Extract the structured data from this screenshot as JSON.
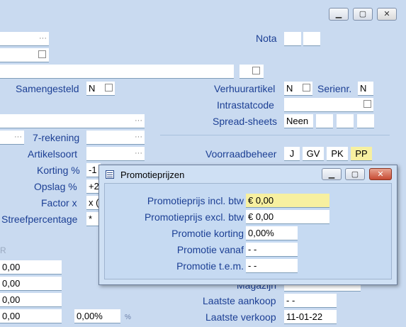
{
  "main": {
    "labels": {
      "nota": "Nota",
      "samengesteld": "Samengesteld",
      "verhuurartikel": "Verhuurartikel",
      "serienr": "Serienr.",
      "intrastatcode": "Intrastatcode",
      "spreadsheets": "Spread-sheets",
      "zeven_rekening": "7-rekening",
      "artikelsoort": "Artikelsoort",
      "korting_pct": "Korting %",
      "opslag_pct": "Opslag %",
      "factor_x": "Factor  x",
      "streefpercentage": "Streefpercentage",
      "voorraadbeheer": "Voorraadbeheer",
      "magazijn": "Magazijn",
      "laatste_aankoop": "Laatste aankoop",
      "laatste_verkoop": "Laatste verkoop",
      "r_header": "R",
      "percent_sign": "%"
    },
    "values": {
      "samengesteld": "N",
      "verhuurartikel": "N",
      "serienr": "N",
      "spreadsheets": "Neen",
      "korting": "-1",
      "opslag": "+2",
      "factor": "x (",
      "streef": "*",
      "price1": "0,00",
      "price2": "0,00",
      "price3": "0,00",
      "price4": "0,00",
      "percent_value": "0,00%",
      "laatste_aankoop": "-  -",
      "laatste_verkoop": "11-01-22",
      "dots": "···"
    },
    "voorraad_codes": [
      "J",
      "GV",
      "PK",
      "PP"
    ],
    "highlight_color": "#f7f0a0"
  },
  "dialog": {
    "title": "Promotieprijzen",
    "rows": [
      {
        "label": "Promotieprijs incl. btw",
        "value": "€ 0,00"
      },
      {
        "label": "Promotieprijs excl. btw",
        "value": "€ 0,00"
      },
      {
        "label": "Promotie korting",
        "value": "0,00%"
      },
      {
        "label": "Promotie vanaf",
        "value": "-  -"
      },
      {
        "label": "Promotie t.e.m.",
        "value": "-  -"
      }
    ]
  },
  "window_controls": {
    "minimize": "▁",
    "maximize": "▢",
    "close": "✕"
  }
}
